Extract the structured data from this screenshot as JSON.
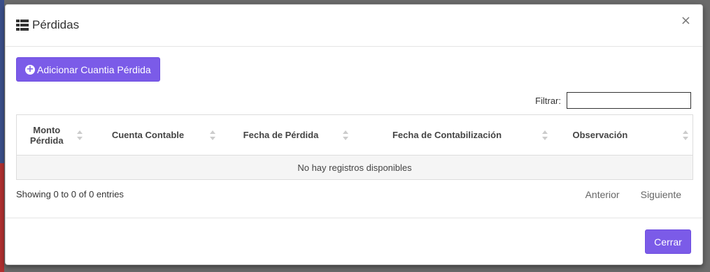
{
  "modal": {
    "title": "Pérdidas",
    "close_symbol": "×"
  },
  "toolbar": {
    "add_label": "Adicionar Cuantia Pérdida",
    "add_icon": "plus-circle-icon"
  },
  "filter": {
    "label": "Filtrar:",
    "value": ""
  },
  "table": {
    "columns": [
      {
        "line1": "Monto",
        "line2": "Pérdida"
      },
      {
        "line1": "Cuenta Contable",
        "line2": ""
      },
      {
        "line1": "Fecha de Pérdida",
        "line2": ""
      },
      {
        "line1": "Fecha de Contabilización",
        "line2": ""
      },
      {
        "line1": "Observación",
        "line2": ""
      }
    ],
    "empty_message": "No hay registros disponibles"
  },
  "info": "Showing 0 to 0 of 0 entries",
  "pagination": {
    "previous": "Anterior",
    "next": "Siguiente"
  },
  "footer": {
    "close_label": "Cerrar"
  },
  "colors": {
    "accent": "#7b5be8"
  }
}
